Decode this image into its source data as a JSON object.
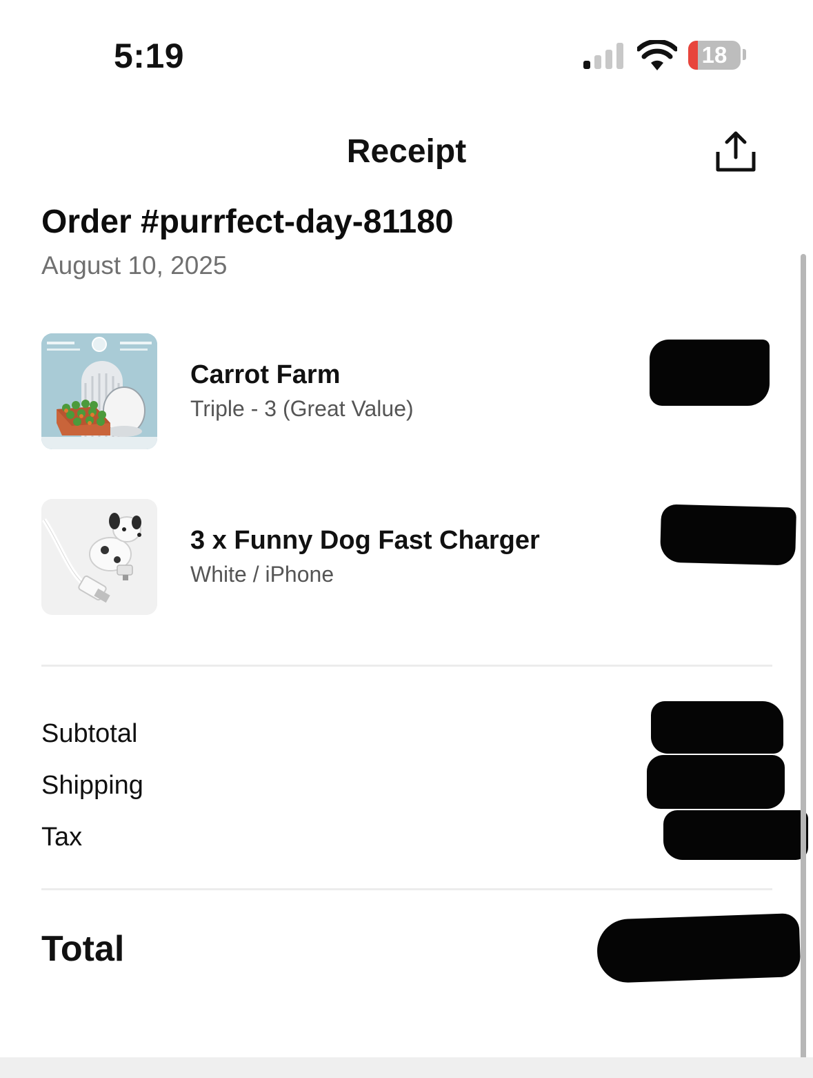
{
  "status_bar": {
    "time": "5:19",
    "battery_percent": "18",
    "signal_bars_active": 1,
    "signal_bars_total": 4
  },
  "header": {
    "title": "Receipt",
    "share_icon": "share-icon"
  },
  "order": {
    "number": "Order #purrfect-day-81180",
    "date": "August 10, 2025"
  },
  "items": [
    {
      "name": "Carrot Farm",
      "variant": "Triple - 3 (Great Value)",
      "thumbnail_icon": "carrot-farm-thumbnail",
      "price": ""
    },
    {
      "name": "3 x Funny Dog Fast Charger",
      "variant": "White / iPhone",
      "thumbnail_icon": "dog-charger-thumbnail",
      "price": ""
    }
  ],
  "summary": {
    "subtotal_label": "Subtotal",
    "shipping_label": "Shipping",
    "tax_label": "Tax",
    "total_label": "Total"
  },
  "colors": {
    "battery_low": "#e8453c",
    "redaction": "#050505",
    "muted_text": "#707070"
  }
}
